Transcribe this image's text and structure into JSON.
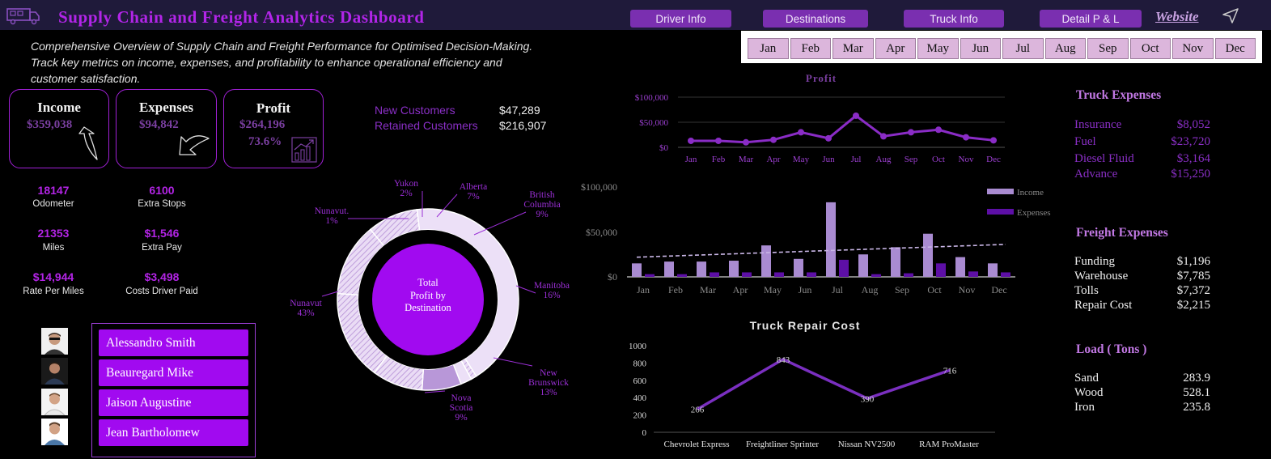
{
  "header": {
    "title": "Supply Chain and Freight  Analytics  Dashboard",
    "nav": [
      "Driver Info",
      "Destinations",
      "Truck Info",
      "Detail P & L"
    ],
    "website": "Website"
  },
  "months": [
    "Jan",
    "Feb",
    "Mar",
    "Apr",
    "May",
    "Jun",
    "Jul",
    "Aug",
    "Sep",
    "Oct",
    "Nov",
    "Dec"
  ],
  "subtitle": "Comprehensive Overview of Supply Chain and Freight Performance for Optimised Decision-Making. Track key metrics on income, expenses, and profitability to enhance operational efficiency and customer satisfaction.",
  "kpis": {
    "income": {
      "label": "Income",
      "value": "$359,038"
    },
    "expenses": {
      "label": "Expenses",
      "value": "$94,842"
    },
    "profit": {
      "label": "Profit",
      "value": "$264,196",
      "pct": "73.6%"
    }
  },
  "customers": {
    "new_label": "New Customers",
    "new_value": "$47,289",
    "retained_label": "Retained Customers",
    "retained_value": "$216,907"
  },
  "metrics": [
    {
      "value": "18147",
      "label": "Odometer"
    },
    {
      "value": "6100",
      "label": "Extra Stops"
    },
    {
      "value": "21353",
      "label": "Miles"
    },
    {
      "value": "$1,546",
      "label": "Extra Pay"
    },
    {
      "value": "$14,944",
      "label": "Rate Per Miles"
    },
    {
      "value": "$3,498",
      "label": "Costs Driver Paid"
    }
  ],
  "drivers": [
    "Alessandro Smith",
    "Beauregard Mike",
    "Jaison Augustine",
    "Jean Bartholomew"
  ],
  "truck_expenses": {
    "title": "Truck Expenses",
    "rows": [
      {
        "label": "Insurance",
        "value": "$8,052"
      },
      {
        "label": "Fuel",
        "value": "$23,720"
      },
      {
        "label": "Diesel Fluid",
        "value": "$3,164"
      },
      {
        "label": "Advance",
        "value": "$15,250"
      }
    ]
  },
  "freight_expenses": {
    "title": "Freight Expenses",
    "rows": [
      {
        "label": "Funding",
        "value": "$1,196"
      },
      {
        "label": "Warehouse",
        "value": "$7,785"
      },
      {
        "label": "Tolls",
        "value": "$7,372"
      },
      {
        "label": "Repair Cost",
        "value": "$2,215"
      }
    ]
  },
  "load": {
    "title": "Load ( Tons )",
    "rows": [
      {
        "label": "Sand",
        "value": "283.9"
      },
      {
        "label": "Wood",
        "value": "528.1"
      },
      {
        "label": "Iron",
        "value": "235.8"
      }
    ]
  },
  "colors": {
    "accent": "#a10af0",
    "purple_text": "#b324e6",
    "light_purple": "#a98bd1",
    "dark_purple": "#5d0fa6",
    "donut_center": "#a10af0"
  },
  "chart_data": [
    {
      "type": "pie",
      "center_label": [
        "Total",
        "Profit by",
        "Destination"
      ],
      "slices": [
        {
          "name": "Nunavut",
          "pct": 43
        },
        {
          "name": "Nunavut.",
          "pct": 1
        },
        {
          "name": "Yukon",
          "pct": 2
        },
        {
          "name": "Alberta",
          "pct": 7
        },
        {
          "name": "British Columbia",
          "pct": 9
        },
        {
          "name": "Manitoba",
          "pct": 16
        },
        {
          "name": "New Brunswick",
          "pct": 13
        },
        {
          "name": "Nova Scotia",
          "pct": 9
        }
      ]
    },
    {
      "type": "line",
      "title": "Profit",
      "categories": [
        "Jan",
        "Feb",
        "Mar",
        "Apr",
        "May",
        "Jun",
        "Jul",
        "Aug",
        "Sep",
        "Oct",
        "Nov",
        "Dec"
      ],
      "values": [
        13000,
        13000,
        10000,
        15000,
        30000,
        18000,
        63000,
        22000,
        30000,
        35000,
        20000,
        14000
      ],
      "yticks": [
        "$0",
        "$50,000",
        "$100,000"
      ],
      "ylim": [
        0,
        100000
      ]
    },
    {
      "type": "bar",
      "categories": [
        "Jan",
        "Feb",
        "Mar",
        "Apr",
        "May",
        "Jun",
        "Jul",
        "Aug",
        "Sep",
        "Oct",
        "Nov",
        "Dec"
      ],
      "series": [
        {
          "name": "Income",
          "values": [
            15000,
            17000,
            17000,
            18000,
            35000,
            20000,
            83000,
            25000,
            33000,
            48000,
            22000,
            15000
          ]
        },
        {
          "name": "Expenses",
          "values": [
            3000,
            3000,
            5000,
            5000,
            5000,
            5000,
            19000,
            3000,
            4000,
            15000,
            6000,
            5000
          ]
        }
      ],
      "trendline": true,
      "yticks": [
        "$0",
        "$50,000",
        "$100,000"
      ],
      "ylim": [
        0,
        100000
      ]
    },
    {
      "type": "line",
      "title": "Truck Repair Cost",
      "categories": [
        "Chevrolet Express",
        "Freightliner Sprinter",
        "Nissan NV2500",
        "RAM ProMaster"
      ],
      "values": [
        266,
        843,
        390,
        716
      ],
      "data_labels": [
        "266",
        "843",
        "390",
        "716"
      ],
      "yticks": [
        "0",
        "200",
        "400",
        "600",
        "800",
        "1000"
      ],
      "ylim": [
        0,
        1000
      ]
    }
  ]
}
